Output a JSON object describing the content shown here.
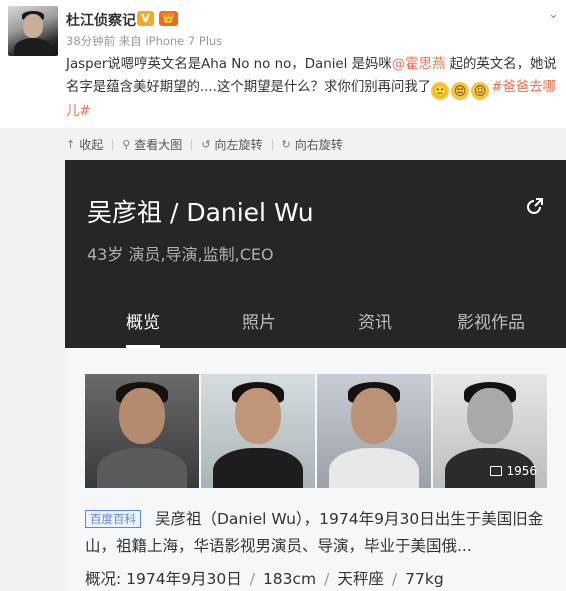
{
  "post": {
    "username": "杜江侦察记",
    "vip_badge": "V",
    "member_badge": "👑",
    "meta": "38分钟前 来自 iPhone 7 Plus",
    "text_part1": "Jasper说嗯哼英文名是Aha  No no no，Daniel 是妈咪",
    "mention": "@霍思燕",
    "text_part2": " 起的英文名，她说名字是蕴含美好期望的....这个期望是什么？求你们别再问我了",
    "emojis": [
      "🙁",
      "😔",
      "😖"
    ],
    "hashtag": "#爸爸去哪儿#"
  },
  "toolbar": {
    "collect": "收起",
    "view_large": "查看大图",
    "rotate_left": "向左旋转",
    "rotate_right": "向右旋转"
  },
  "card": {
    "title": "吴彦祖 / Daniel Wu",
    "subtitle": "43岁  演员,导演,监制,CEO",
    "tabs": [
      "概览",
      "照片",
      "资讯",
      "影视作品"
    ],
    "photo_count": "1956",
    "source_tag": "百度百科",
    "description": "吴彦祖（Daniel Wu），1974年9月30日出生于美国旧金山，祖籍上海，华语影视男演员、导演，毕业于美国俄...",
    "stats_label": "概况:",
    "stats": [
      "1974年9月30日",
      "183cm",
      "天秤座",
      "77kg"
    ]
  },
  "colors": {
    "link": "#eb7350",
    "card_header_bg": "#262626",
    "tag_blue": "#5b8ad6"
  }
}
